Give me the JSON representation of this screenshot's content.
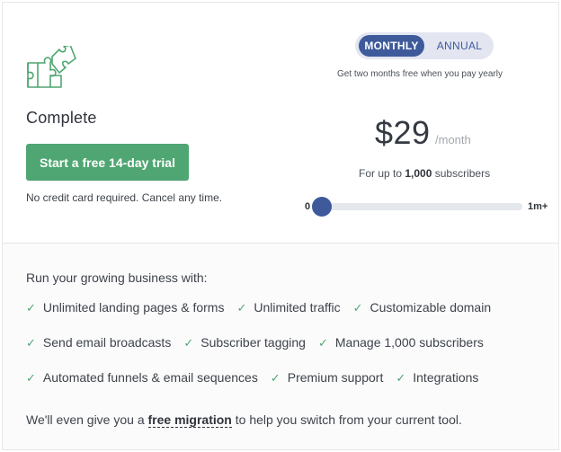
{
  "plan": {
    "icon": "puzzle-icon",
    "name": "Complete",
    "cta_label": "Start a free 14-day trial",
    "cta_note": "No credit card required. Cancel any time."
  },
  "billing": {
    "options": [
      "MONTHLY",
      "ANNUAL"
    ],
    "selected": "MONTHLY",
    "note": "Get two months free when you pay yearly"
  },
  "pricing": {
    "amount": "$29",
    "period": "/month",
    "subscribers_prefix": "For up to",
    "subscribers_count": "1,000",
    "subscribers_suffix": "subscribers"
  },
  "slider": {
    "min_label": "0",
    "max_label": "1m+",
    "value_fraction": 0
  },
  "features": {
    "intro": "Run your growing business with:",
    "rows": [
      [
        "Unlimited landing pages & forms",
        "Unlimited traffic",
        "Customizable domain"
      ],
      [
        "Send email broadcasts",
        "Subscriber tagging",
        "Manage 1,000 subscribers"
      ],
      [
        "Automated funnels & email sequences",
        "Premium support",
        "Integrations"
      ]
    ],
    "check_icon": "check-icon"
  },
  "migration": {
    "prefix": "We'll even give you a",
    "link": "free migration",
    "suffix": "to help you switch from your current tool."
  },
  "colors": {
    "accent_green": "#4fa672",
    "accent_blue": "#3e5a9b"
  }
}
